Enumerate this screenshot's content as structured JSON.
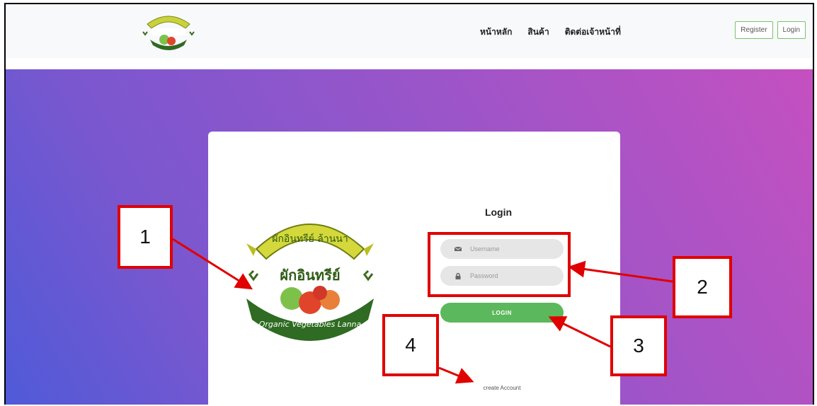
{
  "nav": {
    "links": [
      "หน้าหลัก",
      "สินค้า",
      "ติดต่อเจ้าหน้าที่"
    ],
    "register_label": "Register",
    "login_label": "Login"
  },
  "logo": {
    "banner_text": "ผักอินทรีย์ ล้านนา",
    "main_text": "ผักอินทรีย์",
    "ribbon_text": "Organic Vegetables Lanna"
  },
  "login_form": {
    "title": "Login",
    "username_placeholder": "Username",
    "password_placeholder": "Password",
    "button_label": "LOGIN",
    "create_account": "create Account"
  },
  "annotations": [
    "1",
    "2",
    "3",
    "4"
  ],
  "colors": {
    "accent_green": "#5cb85c",
    "callout_red": "#e00000",
    "gradient_start": "#4f5ad8",
    "gradient_end": "#c550c0"
  }
}
